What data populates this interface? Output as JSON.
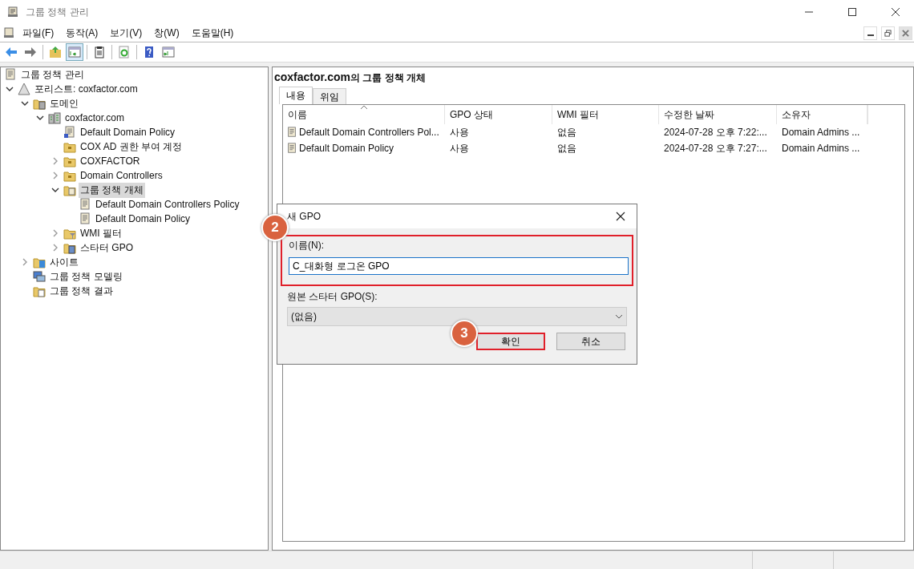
{
  "window": {
    "title": "그룹 정책 관리"
  },
  "menu": [
    "파일(F)",
    "동작(A)",
    "보기(V)",
    "창(W)",
    "도움말(H)"
  ],
  "toolbar": [
    {
      "kind": "back",
      "selected": false
    },
    {
      "kind": "forward",
      "selected": false
    },
    {
      "kind": "sep"
    },
    {
      "kind": "up",
      "selected": false
    },
    {
      "kind": "tree",
      "selected": true
    },
    {
      "kind": "sep"
    },
    {
      "kind": "clipboard",
      "selected": false
    },
    {
      "kind": "sep"
    },
    {
      "kind": "refresh",
      "selected": false
    },
    {
      "kind": "sep"
    },
    {
      "kind": "help",
      "selected": false
    },
    {
      "kind": "pane",
      "selected": false
    }
  ],
  "tree": [
    {
      "label": "그룹 정책 관리",
      "kind": "console",
      "selected": false,
      "children": [
        {
          "label": "포리스트: coxfactor.com",
          "kind": "forest",
          "expanded": true,
          "selected": false,
          "children": [
            {
              "label": "도메인",
              "kind": "domains",
              "expanded": true,
              "selected": false,
              "children": [
                {
                  "label": "coxfactor.com",
                  "kind": "domain",
                  "expanded": true,
                  "selected": false,
                  "children": [
                    {
                      "label": "Default Domain Policy",
                      "kind": "gpolink",
                      "selected": false
                    },
                    {
                      "label": "COX AD 권한 부여 계정",
                      "kind": "ou",
                      "selected": false
                    },
                    {
                      "label": "COXFACTOR",
                      "kind": "ou",
                      "expanded": false,
                      "selected": false
                    },
                    {
                      "label": "Domain Controllers",
                      "kind": "ou",
                      "expanded": false,
                      "selected": false
                    },
                    {
                      "label": "그룹 정책 개체",
                      "kind": "gpofolder",
                      "expanded": true,
                      "selected": true,
                      "children": [
                        {
                          "label": "Default Domain Controllers Policy",
                          "kind": "gpo",
                          "selected": false
                        },
                        {
                          "label": "Default Domain Policy",
                          "kind": "gpo",
                          "selected": false
                        }
                      ]
                    },
                    {
                      "label": "WMI 필터",
                      "kind": "wmi",
                      "expanded": false,
                      "selected": false
                    },
                    {
                      "label": "스타터 GPO",
                      "kind": "starter",
                      "expanded": false,
                      "selected": false
                    }
                  ]
                }
              ]
            },
            {
              "label": "사이트",
              "kind": "sites",
              "expanded": false,
              "selected": false
            },
            {
              "label": "그룹 정책 모델링",
              "kind": "modeling",
              "selected": false
            },
            {
              "label": "그룹 정책 결과",
              "kind": "results",
              "selected": false
            }
          ]
        }
      ]
    }
  ],
  "content": {
    "title_bold": "coxfactor.com",
    "title_rest": "의 그룹 정책 개체",
    "tabs": [
      {
        "label": "내용",
        "selected": true
      },
      {
        "label": "위임",
        "selected": false
      }
    ],
    "columns": [
      "이름",
      "GPO 상태",
      "WMI 필터",
      "수정한 날짜",
      "소유자"
    ],
    "rows": [
      [
        "Default Domain Controllers Pol...",
        "사용",
        "없음",
        "2024-07-28 오후 7:22:...",
        "Domain Admins ..."
      ],
      [
        "Default Domain Policy",
        "사용",
        "없음",
        "2024-07-28 오후 7:27:...",
        "Domain Admins ..."
      ]
    ]
  },
  "dialog": {
    "title": "새 GPO",
    "name_label": "이름(N):",
    "name_value": "C_대화형 로그온 GPO",
    "name_highlighted": true,
    "name_step": "2",
    "starter_label": "원본 스타터 GPO(S):",
    "starter_value": "(없음)",
    "buttons": [
      {
        "label": "확인",
        "highlighted": true,
        "step": "3"
      },
      {
        "label": "취소",
        "highlighted": false
      }
    ]
  }
}
